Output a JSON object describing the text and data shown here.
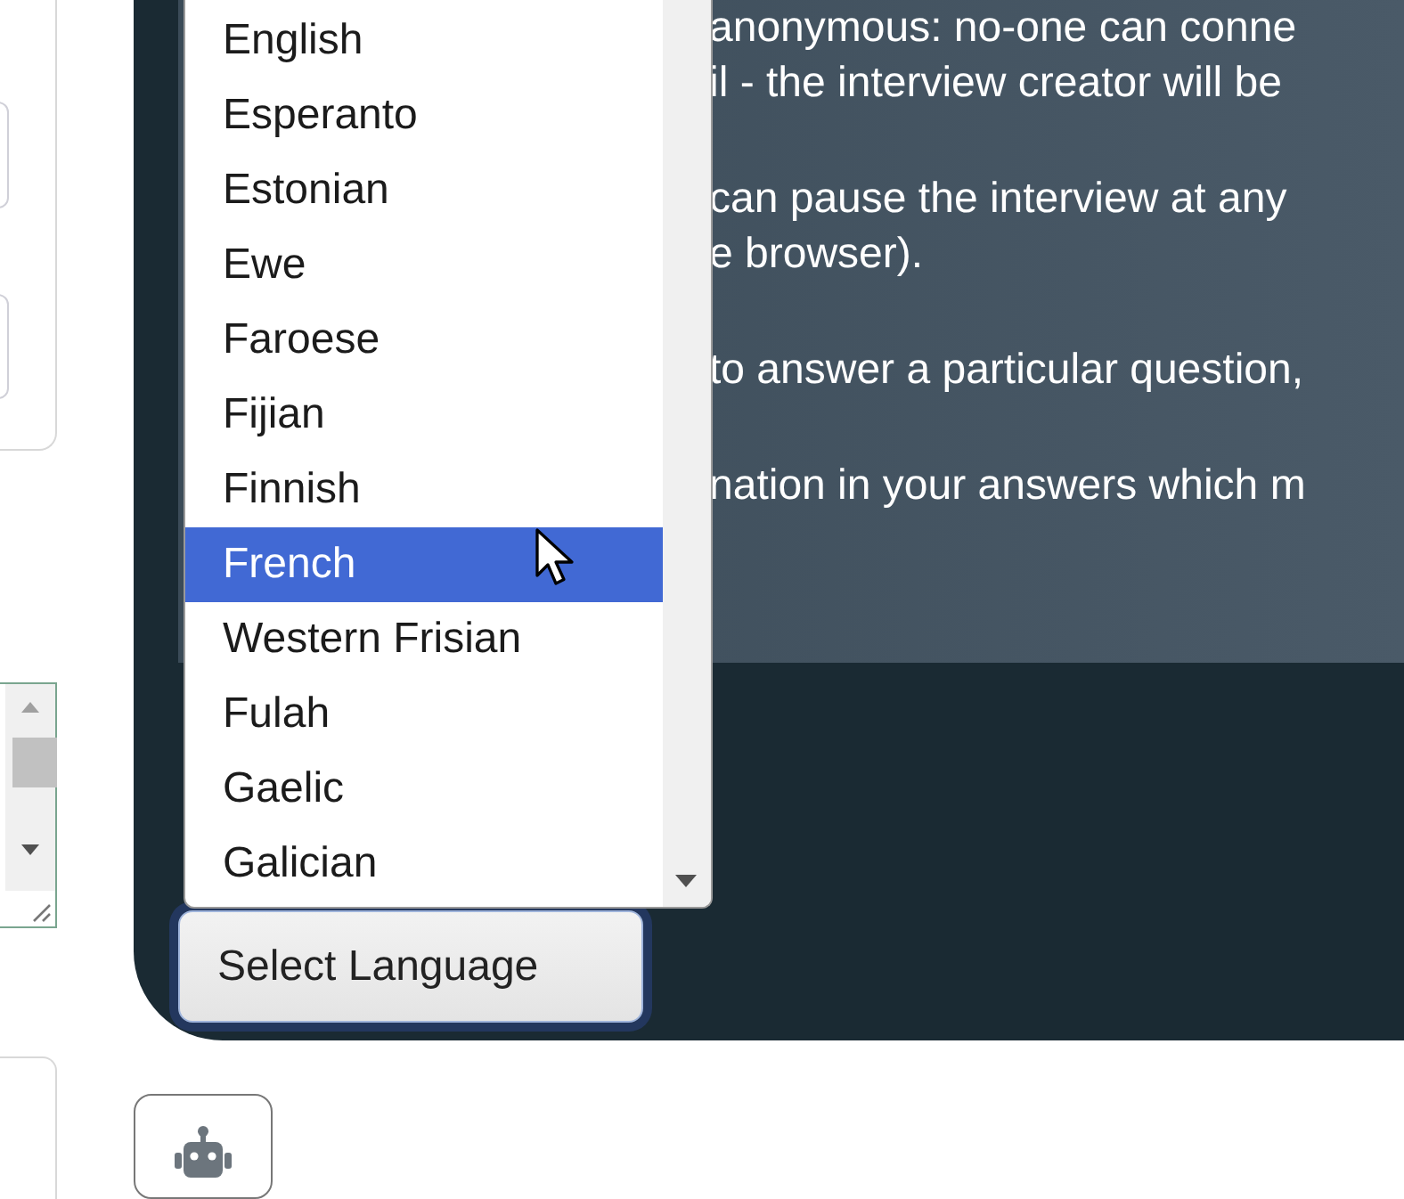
{
  "language_list": {
    "items": [
      {
        "label": "English",
        "selected": false
      },
      {
        "label": "Esperanto",
        "selected": false
      },
      {
        "label": "Estonian",
        "selected": false
      },
      {
        "label": "Ewe",
        "selected": false
      },
      {
        "label": "Faroese",
        "selected": false
      },
      {
        "label": "Fijian",
        "selected": false
      },
      {
        "label": "Finnish",
        "selected": false
      },
      {
        "label": "French",
        "selected": true
      },
      {
        "label": "Western Frisian",
        "selected": false
      },
      {
        "label": "Fulah",
        "selected": false
      },
      {
        "label": "Gaelic",
        "selected": false
      },
      {
        "label": "Galician",
        "selected": false
      }
    ]
  },
  "select_button": {
    "label": "Select Language"
  },
  "info_paragraphs": [
    [
      "anonymous: no-one can conne",
      "il - the interview creator will be"
    ],
    [
      "can pause the interview at any",
      "e browser)."
    ],
    [
      "to answer a particular question,"
    ],
    [
      "nation in your answers which m"
    ]
  ]
}
